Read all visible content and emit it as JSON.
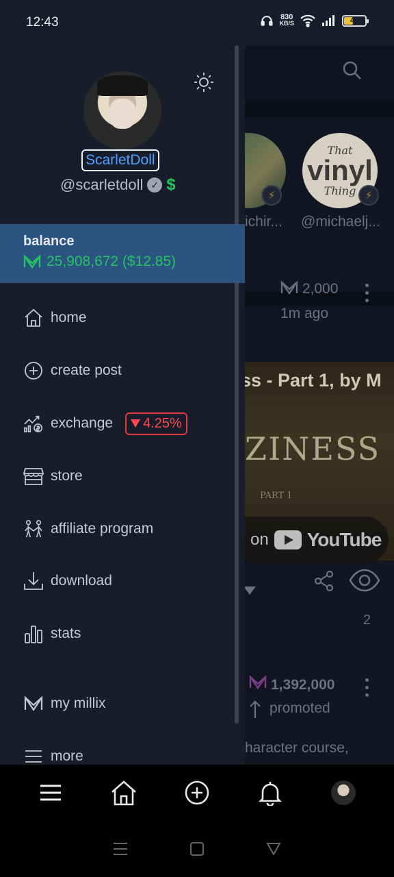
{
  "status_bar": {
    "time": "12:43",
    "net_speed_value": "830",
    "net_speed_unit": "KB/S",
    "battery": "40"
  },
  "drawer": {
    "display_name": "ScarletDoll",
    "handle": "@scarletdoll",
    "dollar_badge": "$",
    "balance": {
      "label": "balance",
      "amount": "25,908,672 ($12.85)"
    },
    "menu": [
      {
        "label": "home",
        "icon": "home-icon"
      },
      {
        "label": "create post",
        "icon": "plus-circle-icon"
      },
      {
        "label": "exchange",
        "icon": "exchange-icon",
        "badge": "4.25%"
      },
      {
        "label": "store",
        "icon": "store-icon"
      },
      {
        "label": "affiliate program",
        "icon": "affiliate-icon"
      },
      {
        "label": "download",
        "icon": "download-icon"
      },
      {
        "label": "stats",
        "icon": "stats-icon"
      },
      {
        "label": "my millix",
        "icon": "millix-icon"
      },
      {
        "label": "more",
        "icon": "menu-icon"
      }
    ]
  },
  "feed": {
    "stories": [
      {
        "label": "ichir..."
      },
      {
        "label": "@michaelj...",
        "logo_line1": "That",
        "logo_line2": "vinyl",
        "logo_line3": "Thing"
      }
    ],
    "post1": {
      "coins": "2,000",
      "time": "1m ago",
      "video_title": "ss - Part 1, by M",
      "video_big_text": "ZINESS",
      "video_part": "PART 1",
      "video_on": "on",
      "video_brand": "YouTube",
      "views": "2"
    },
    "post2": {
      "coins": "1,392,000",
      "label": "promoted",
      "text": "haracter course,"
    }
  },
  "colors": {
    "drawer_bg": "#181c2b",
    "balance_bg": "#2b5482",
    "accent_green": "#22c55e",
    "accent_blue": "#4ea0ff",
    "badge_red": "#e23a3a"
  }
}
